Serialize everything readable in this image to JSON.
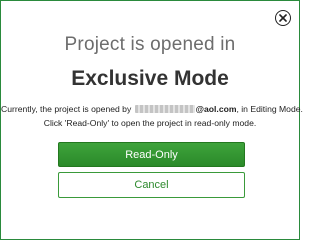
{
  "dialog": {
    "title_line1": "Project is opened in",
    "title_line2": "Exclusive Mode",
    "message_prefix": "Currently, the project is opened by",
    "email_domain": "@aol.com",
    "message_suffix": ", in Editing Mode.",
    "message_line2": "Click 'Read-Only' to open the project in read-only mode.",
    "readonly_label": "Read-Only",
    "cancel_label": "Cancel",
    "close_icon": "close-circle-icon"
  },
  "colors": {
    "accent_green": "#2b8a2a",
    "border_green": "#2a8a3c",
    "title_gray": "#6d6d6d"
  }
}
